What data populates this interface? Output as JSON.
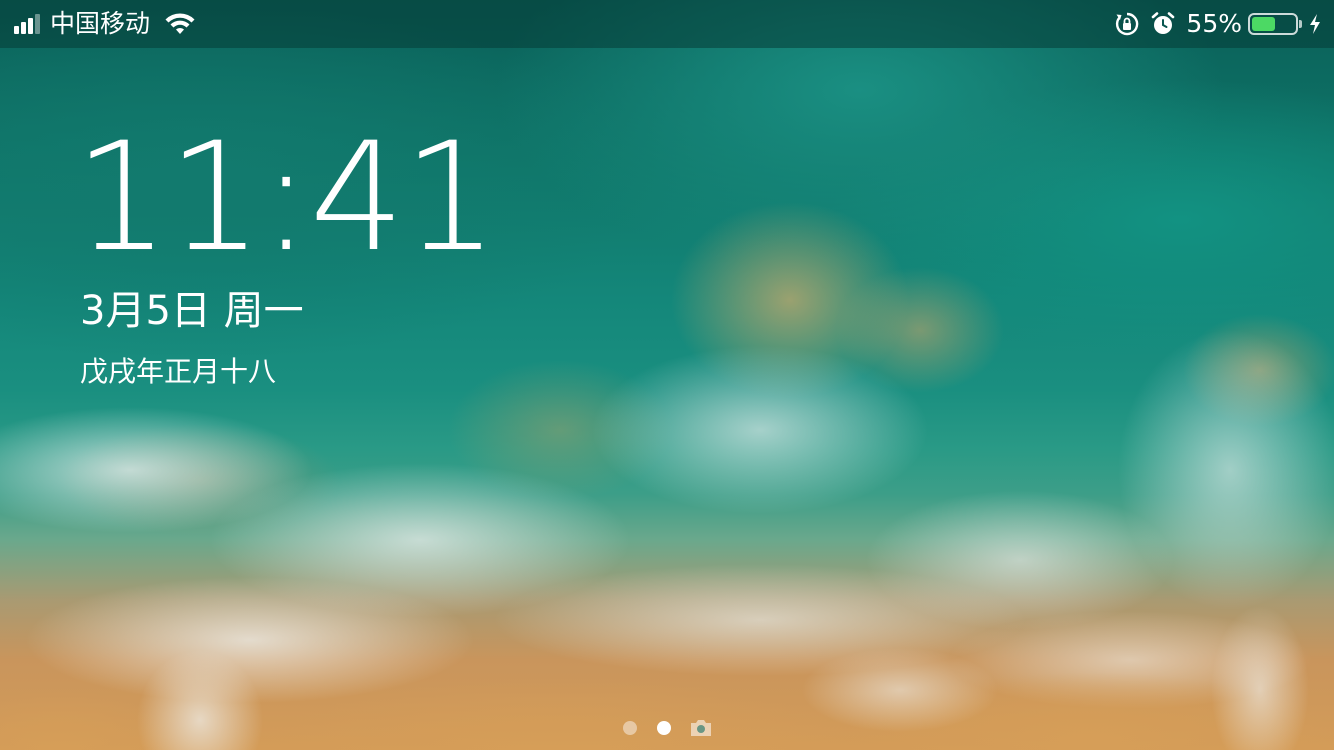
{
  "status_bar": {
    "signal_bars": 4,
    "signal_active": 3,
    "carrier": "中国移动",
    "wifi_icon": "wifi-icon",
    "rotation_lock_icon": "rotation-lock-icon",
    "alarm_icon": "alarm-icon",
    "battery_percent": "55%",
    "battery_level": 0.55,
    "charging_icon": "bolt-icon",
    "battery_color": "#4cd964"
  },
  "lock_screen": {
    "time": "11:41",
    "date": "3月5日 周一",
    "lunar_date": "戊戌年正月十八"
  },
  "page_indicator": {
    "pages": 2,
    "active_index": 1,
    "camera_icon": "camera-icon"
  }
}
